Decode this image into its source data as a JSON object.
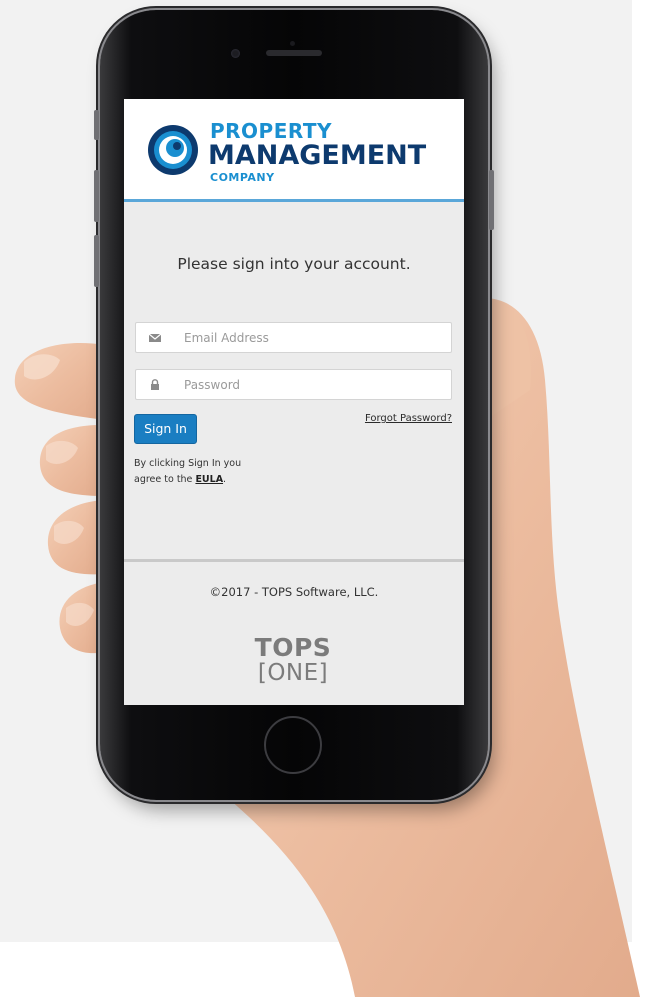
{
  "logo": {
    "line1": "PROPERTY",
    "line2": "MANAGEMENT",
    "line3": "COMPANY"
  },
  "login": {
    "prompt": "Please sign into your account.",
    "email_placeholder": "Email Address",
    "password_placeholder": "Password",
    "signin_label": "Sign In",
    "forgot_label": "Forgot Password?",
    "eula_text": "By clicking Sign In you agree to the",
    "eula_link": "EULA",
    "eula_end": "."
  },
  "footer": {
    "copyright": "©2017 - TOPS Software, LLC.",
    "brand_line1": "TOPS",
    "brand_line2": "[ONE]"
  },
  "colors": {
    "accent": "#1a7ec2",
    "logo_light": "#1a8fd0",
    "logo_dark": "#0d3a6e",
    "header_rule": "#5aa7d9"
  },
  "icons": {
    "email": "envelope-icon",
    "password": "lock-icon"
  }
}
